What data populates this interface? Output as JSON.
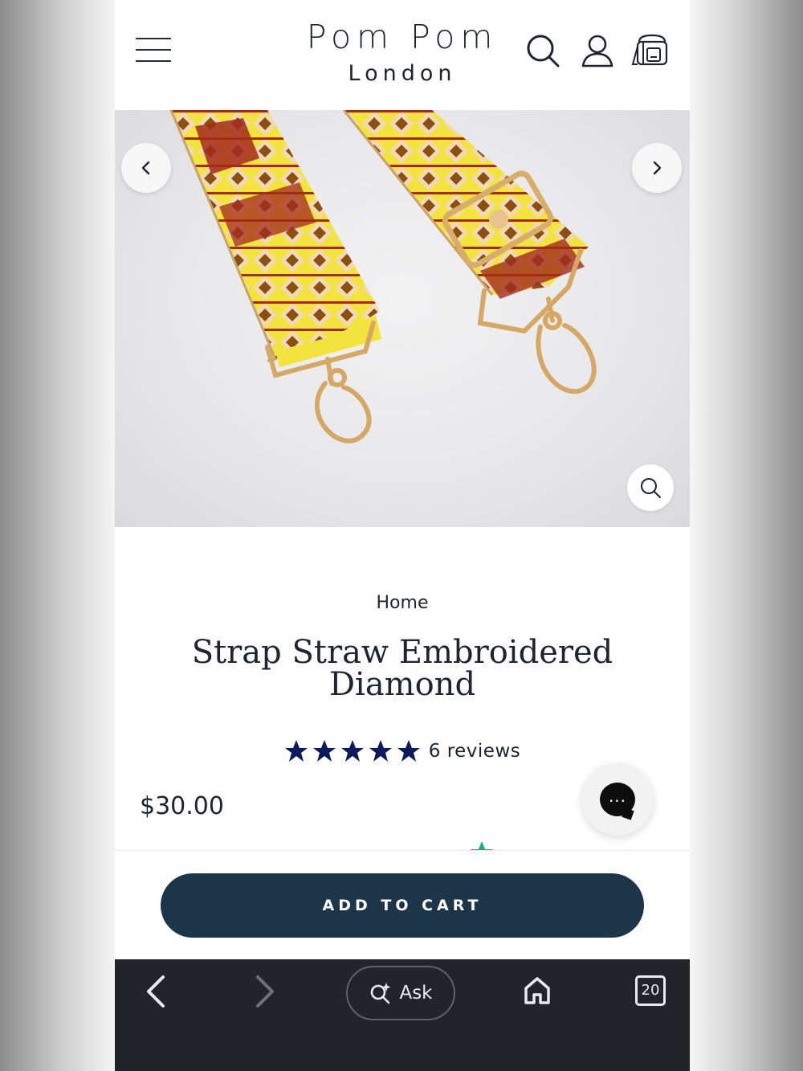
{
  "header": {
    "brand_line1": "Pom Pom",
    "brand_line2": "London",
    "menu_icon": "hamburger-menu-icon",
    "search_icon": "search-icon",
    "account_icon": "user-icon",
    "cart_icon": "bag-icon"
  },
  "gallery": {
    "prev_icon": "chevron-left-icon",
    "next_icon": "chevron-right-icon",
    "zoom_icon": "magnifier-icon"
  },
  "product": {
    "breadcrumb": "Home",
    "title": "Strap Straw Embroidered Diamond",
    "rating_stars": 5,
    "reviews": "6 reviews",
    "price": "$30.00",
    "star_color": "#0d1a5e"
  },
  "cart": {
    "add_label": "ADD TO CART",
    "button_color": "#1d3549"
  },
  "browser": {
    "back_icon": "back-arrow-icon",
    "forward_icon": "forward-arrow-icon",
    "ask_label": "Ask",
    "home_icon": "home-icon",
    "tabs_count": "20"
  }
}
